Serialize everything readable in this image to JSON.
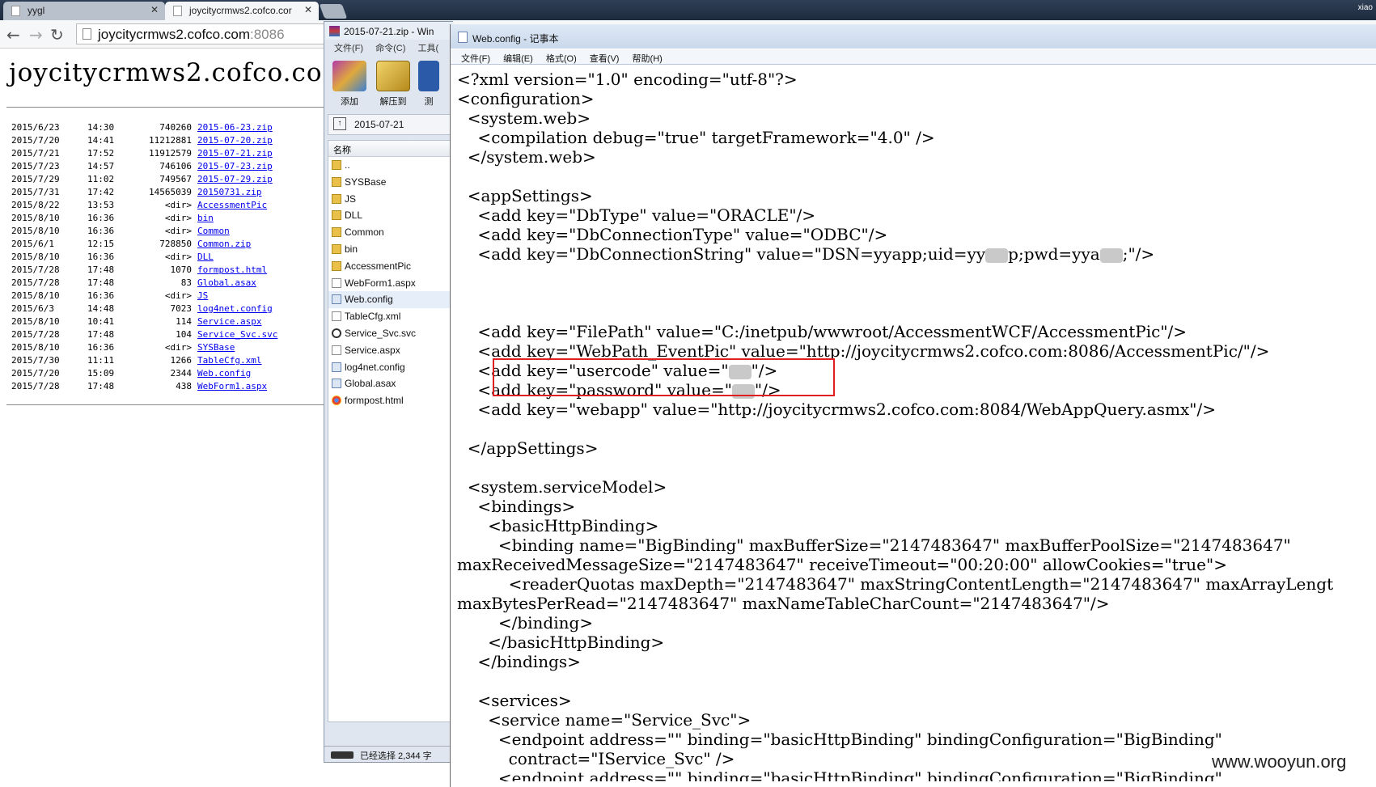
{
  "browser": {
    "tabs": [
      {
        "title": "yygl",
        "close": "✕"
      },
      {
        "title": "joycitycrmws2.cofco.cor",
        "close": "✕"
      }
    ],
    "address": {
      "host": "joycitycrmws2.cofco.com",
      "port": ":8086"
    },
    "page_heading": "joycitycrmws2.cofco.co",
    "listing": [
      {
        "date": "2015/6/23",
        "time": "14:30",
        "size": "740260",
        "name": "2015-06-23.zip"
      },
      {
        "date": "2015/7/20",
        "time": "14:41",
        "size": "11212881",
        "name": "2015-07-20.zip"
      },
      {
        "date": "2015/7/21",
        "time": "17:52",
        "size": "11912579",
        "name": "2015-07-21.zip"
      },
      {
        "date": "2015/7/23",
        "time": "14:57",
        "size": "746106",
        "name": "2015-07-23.zip"
      },
      {
        "date": "2015/7/29",
        "time": "11:02",
        "size": "749567",
        "name": "2015-07-29.zip"
      },
      {
        "date": "2015/7/31",
        "time": "17:42",
        "size": "14565039",
        "name": "20150731.zip"
      },
      {
        "date": "2015/8/22",
        "time": "13:53",
        "size": "<dir>",
        "name": "AccessmentPic"
      },
      {
        "date": "2015/8/10",
        "time": "16:36",
        "size": "<dir>",
        "name": "bin"
      },
      {
        "date": "2015/8/10",
        "time": "16:36",
        "size": "<dir>",
        "name": "Common"
      },
      {
        "date": "2015/6/1",
        "time": "12:15",
        "size": "728850",
        "name": "Common.zip"
      },
      {
        "date": "2015/8/10",
        "time": "16:36",
        "size": "<dir>",
        "name": "DLL"
      },
      {
        "date": "2015/7/28",
        "time": "17:48",
        "size": "1070",
        "name": "formpost.html"
      },
      {
        "date": "2015/7/28",
        "time": "17:48",
        "size": "83",
        "name": "Global.asax"
      },
      {
        "date": "2015/8/10",
        "time": "16:36",
        "size": "<dir>",
        "name": "JS"
      },
      {
        "date": "2015/6/3",
        "time": "14:48",
        "size": "7023",
        "name": "log4net.config"
      },
      {
        "date": "2015/8/10",
        "time": "10:41",
        "size": "114",
        "name": "Service.aspx"
      },
      {
        "date": "2015/7/28",
        "time": "17:48",
        "size": "104",
        "name": "Service_Svc.svc"
      },
      {
        "date": "2015/8/10",
        "time": "16:36",
        "size": "<dir>",
        "name": "SYSBase"
      },
      {
        "date": "2015/7/30",
        "time": "11:11",
        "size": "1266",
        "name": "TableCfg.xml"
      },
      {
        "date": "2015/7/20",
        "time": "15:09",
        "size": "2344",
        "name": "Web.config"
      },
      {
        "date": "2015/7/28",
        "time": "17:48",
        "size": "438",
        "name": "WebForm1.aspx"
      }
    ]
  },
  "winrar": {
    "title": "2015-07-21.zip - Win",
    "menu": [
      "文件(F)",
      "命令(C)",
      "工具("
    ],
    "tools": [
      "添加",
      "解压到",
      "测"
    ],
    "path": "2015-07-21",
    "column_header": "名称",
    "items": [
      {
        "name": "..",
        "icon": "folder"
      },
      {
        "name": "SYSBase",
        "icon": "folder"
      },
      {
        "name": "JS",
        "icon": "folder"
      },
      {
        "name": "DLL",
        "icon": "folder"
      },
      {
        "name": "Common",
        "icon": "folder"
      },
      {
        "name": "bin",
        "icon": "folder"
      },
      {
        "name": "AccessmentPic",
        "icon": "folder"
      },
      {
        "name": "WebForm1.aspx",
        "icon": "file"
      },
      {
        "name": "Web.config",
        "icon": "config"
      },
      {
        "name": "TableCfg.xml",
        "icon": "file"
      },
      {
        "name": "Service_Svc.svc",
        "icon": "svc"
      },
      {
        "name": "Service.aspx",
        "icon": "file"
      },
      {
        "name": "log4net.config",
        "icon": "config"
      },
      {
        "name": "Global.asax",
        "icon": "config"
      },
      {
        "name": "formpost.html",
        "icon": "web"
      }
    ],
    "status": "已经选择 2,344 字"
  },
  "notepad": {
    "title": "Web.config - 记事本",
    "menu": [
      "文件(F)",
      "编辑(E)",
      "格式(O)",
      "查看(V)",
      "帮助(H)"
    ],
    "lines": [
      "<?xml version=\"1.0\" encoding=\"utf-8\"?>",
      "<configuration>",
      "  <system.web>",
      "    <compilation debug=\"true\" targetFramework=\"4.0\" />",
      "  </system.web>",
      "",
      "  <appSettings>",
      "    <add key=\"DbType\" value=\"ORACLE\"/>",
      "    <add key=\"DbConnectionType\" value=\"ODBC\"/>",
      "    <add key=\"DbConnectionString\" value=\"DSN=yyapp;uid=yy[[B]]p;pwd=yya[[B]];\"/>",
      "",
      "",
      "",
      "    <add key=\"FilePath\" value=\"C:/inetpub/wwwroot/AccessmentWCF/AccessmentPic\"/>",
      "    <add key=\"WebPath_EventPic\" value=\"http://joycitycrmws2.cofco.com:8086/AccessmentPic/\"/>",
      "    <add key=\"usercode\" value=\"[[B]]\"/>",
      "    <add key=\"password\" value=\"[[B]]\"/>",
      "    <add key=\"webapp\" value=\"http://joycitycrmws2.cofco.com:8084/WebAppQuery.asmx\"/>",
      "",
      "  </appSettings>",
      "",
      "  <system.serviceModel>",
      "    <bindings>",
      "      <basicHttpBinding>",
      "        <binding name=\"BigBinding\" maxBufferSize=\"2147483647\" maxBufferPoolSize=\"2147483647\"",
      "maxReceivedMessageSize=\"2147483647\" receiveTimeout=\"00:20:00\" allowCookies=\"true\">",
      "          <readerQuotas maxDepth=\"2147483647\" maxStringContentLength=\"2147483647\" maxArrayLengt",
      "maxBytesPerRead=\"2147483647\" maxNameTableCharCount=\"2147483647\"/>",
      "        </binding>",
      "      </basicHttpBinding>",
      "    </bindings>",
      "",
      "    <services>",
      "      <service name=\"Service_Svc\">",
      "        <endpoint address=\"\" binding=\"basicHttpBinding\" bindingConfiguration=\"BigBinding\"",
      "          contract=\"IService_Svc\" />",
      "        <endpoint address=\"\" binding=\"basicHttpBinding\" bindingConfiguration=\"BigBinding\""
    ]
  },
  "watermark": "www.wooyun.org",
  "user_label": "xiao",
  "colors": {
    "highlight_box": "#e02020",
    "link": "#0000ee",
    "tabstrip": "#1d2b3f"
  }
}
